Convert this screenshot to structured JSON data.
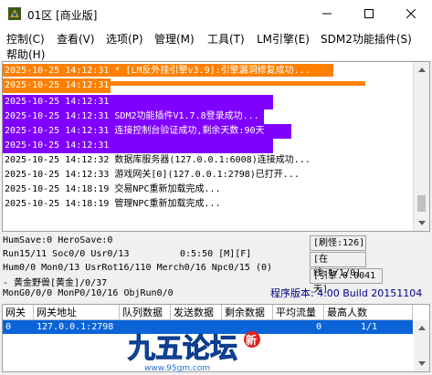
{
  "window": {
    "title": "01区 [商业版]",
    "icon": "game-app-icon"
  },
  "menu": [
    {
      "label": "控制(C)"
    },
    {
      "label": "查看(V)"
    },
    {
      "label": "选项(P)"
    },
    {
      "label": "管理(M)"
    },
    {
      "label": "工具(T)"
    },
    {
      "label": "LM引擎(E)"
    },
    {
      "label": "SDM2功能插件(S)"
    },
    {
      "label": "帮助(H)"
    }
  ],
  "log": {
    "highlight_colors": {
      "orange": "#ff8000",
      "purple": "#8000ff"
    },
    "lines": [
      {
        "time": "2025-10-25 14:12:31",
        "text": " * [LM反外挂引擎v3.9]:引擎漏洞修复成功...",
        "hl": "orange"
      },
      {
        "time": "2025-10-25 14:12:31",
        "text": "",
        "hl": "orange"
      },
      {
        "time": "2025-10-25 14:12:31",
        "text": "",
        "hl": "purple"
      },
      {
        "time": "2025-10-25 14:12:31",
        "text": " SDM2功能插件V1.7.8登录成功...",
        "hl": "purple"
      },
      {
        "time": "2025-10-25 14:12:31",
        "text": " 连接控制台验证成功,剩余天数:90天",
        "hl": "purple"
      },
      {
        "time": "2025-10-25 14:12:31",
        "text": "",
        "hl": "purple"
      },
      {
        "time": "2025-10-25 14:12:32",
        "text": " 数据库服务器(127.0.0.1:6008)连接成功...",
        "hl": ""
      },
      {
        "time": "2025-10-25 14:12:33",
        "text": " 游戏网关[0](127.0.0.1:2798)已打开...",
        "hl": ""
      },
      {
        "time": "2025-10-25 14:18:19",
        "text": " 交易NPC重新加载完成...",
        "hl": ""
      },
      {
        "time": "2025-10-25 14:18:19",
        "text": " 管理NPC重新加载完成...",
        "hl": ""
      }
    ]
  },
  "status": {
    "line1": "HumSave:0 HeroSave:0",
    "line2": "Run15/11 Soc0/0 Usr0/13",
    "time": "0:5:50 [M][F]",
    "line3": "Hum0/0 Mon0/13 UsrRot16/110 Merch0/16 Npc0/15 (0)",
    "line4": "- 黄金野兽[黄金]/0/37",
    "line5": "MonG0/0/0 MonP0/10/16 ObjRun0/0",
    "refresh": "[刷怪:126]",
    "online": "[在线:1/1/0]",
    "engine": "[引擎.0.0041天]",
    "version": "程序版本: 4.00 Build 20151104"
  },
  "table": {
    "columns": [
      "网关",
      "网关地址",
      "队列数据",
      "发送数据",
      "剩余数据",
      "平均流量",
      "最高人数"
    ],
    "rows": [
      [
        "0",
        "127.0.0.1:2798",
        "",
        "",
        "",
        "0",
        "1/1"
      ]
    ]
  },
  "watermark": {
    "text": "九五论坛",
    "badge": "新",
    "url": "www.95gm.com"
  }
}
